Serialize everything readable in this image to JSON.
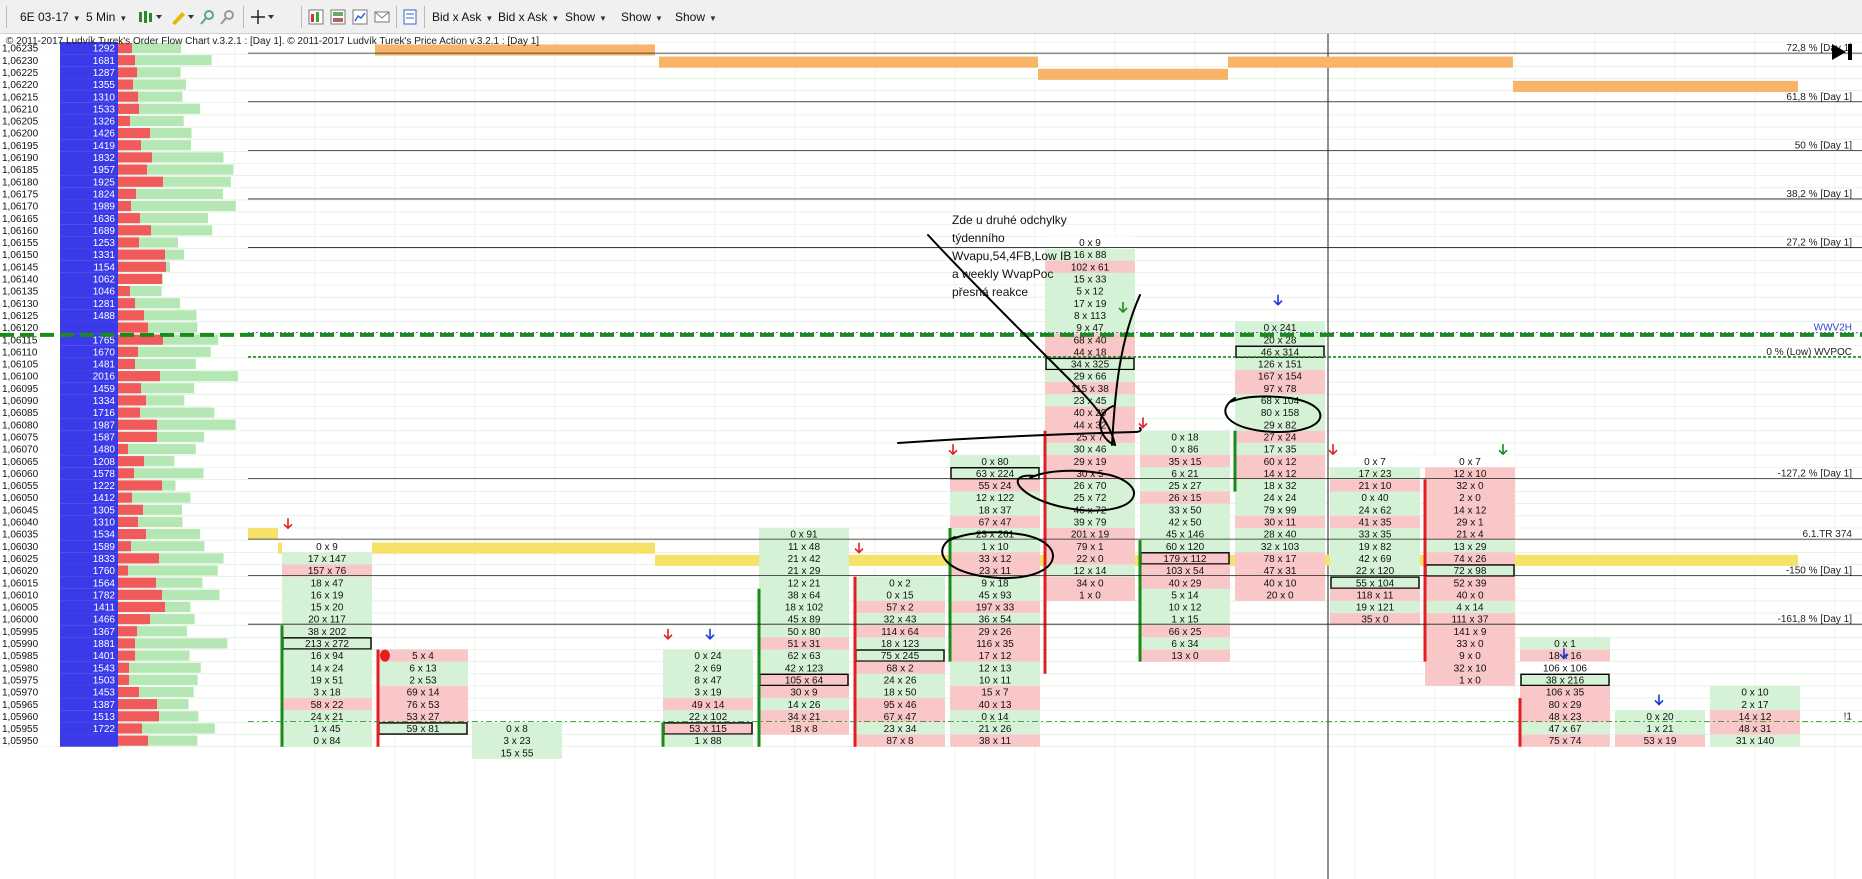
{
  "toolbar": {
    "instrument": "6E 03-17",
    "timeframe": "5 Min",
    "dropdowns": [
      "Bid x Ask",
      "Bid x Ask",
      "Show",
      "Show",
      "Show"
    ]
  },
  "copyright": "© 2011-2017 Ludvík Turek's Order Flow Chart v.3.2.1 : [Day 1]. © 2011-2017 Ludvík Turek's Price Action v.3.2.1 : [Day 1]",
  "note_lines": [
    "Zde u druhé odchylky",
    "týdenního",
    "Wvapu,54,4FB,Low IB",
    "a weekly WvapPoc",
    "přesná reakce"
  ],
  "colors": {
    "ask": "#f05a5a",
    "bid": "#b5e7b5",
    "volume": "#3a3ae8",
    "orange": "#f8b469",
    "yellow": "#f6e169",
    "green_line": "#1a8a1a"
  },
  "ladder": {
    "prices": [
      "1,06235",
      "1,06230",
      "1,06225",
      "1,06220",
      "1,06215",
      "1,06210",
      "1,06205",
      "1,06200",
      "1,06195",
      "1,06190",
      "1,06185",
      "1,06180",
      "1,06175",
      "1,06170",
      "1,06165",
      "1,06160",
      "1,06155",
      "1,06150",
      "1,06145",
      "1,06140",
      "1,06135",
      "1,06130",
      "1,06125",
      "1,06120",
      "1,06115",
      "1,06110",
      "1,06105",
      "1,06100",
      "1,06095",
      "1,06090",
      "1,06085",
      "1,06080",
      "1,06075",
      "1,06070",
      "1,06065",
      "1,06060",
      "1,06055",
      "1,06050",
      "1,06045",
      "1,06040",
      "1,06035",
      "1,06030",
      "1,06025",
      "1,06020",
      "1,06015",
      "1,06010",
      "1,06005",
      "1,06000",
      "1,05995",
      "1,05990",
      "1,05985",
      "1,05980",
      "1,05975",
      "1,05970",
      "1,05965",
      "1,05960",
      "1,05955",
      "1,05950"
    ],
    "volumes": [
      "1292",
      "1681",
      "1287",
      "1355",
      "1310",
      "1533",
      "1326",
      "1426",
      "1419",
      "1832",
      "1957",
      "1925",
      "1824",
      "1989",
      "1636",
      "1689",
      "1253",
      "1331",
      "1154",
      "1062",
      "1046",
      "1281",
      "1488",
      "",
      "1765",
      "1670",
      "1481",
      "2016",
      "1459",
      "1334",
      "1716",
      "1987",
      "1587",
      "1480",
      "1208",
      "1578",
      "1222",
      "1412",
      "1305",
      "1310",
      "1534",
      "1589",
      "1833",
      "1760",
      "1564",
      "1782",
      "1411",
      "1466",
      "1367",
      "1881",
      "1401",
      "1543",
      "1503",
      "1453",
      "1387",
      "1513",
      "1722"
    ]
  },
  "levels": [
    {
      "label": "72,8 % [Day 1]",
      "value": 1.06235
    },
    {
      "label": "61,8 % [Day 1]",
      "value": 1.06215
    },
    {
      "label": "50 % [Day 1]",
      "value": 1.06195
    },
    {
      "label": "38,2 % [Day 1]",
      "value": 1.06175
    },
    {
      "label": "27,2 % [Day 1]",
      "value": 1.06155
    },
    {
      "label": "WWV2H",
      "value": 1.0612
    },
    {
      "label": "0 % (Low) WVPOC",
      "value": 1.0611
    },
    {
      "label": "-127,2 % [Day 1]",
      "value": 1.0606
    },
    {
      "label": "6.1.TR 374",
      "value": 1.06035
    },
    {
      "label": "-150 % [Day 1]",
      "value": 1.0602
    },
    {
      "label": "-161,8 % [Day 1]",
      "value": 1.06
    },
    {
      "label": "!1",
      "value": 1.0596
    }
  ],
  "bars": [
    {
      "cells": [
        [
          "0 x 9",
          "n"
        ],
        [
          "17 x 147",
          "b"
        ],
        [
          "157 x 76",
          "a"
        ],
        [
          "18 x 47",
          "b"
        ],
        [
          "16 x 19",
          "b"
        ],
        [
          "15 x 20",
          "b"
        ],
        [
          "20 x 117",
          "b"
        ],
        [
          "38 x 202",
          "b"
        ],
        [
          "213 x 272",
          "b"
        ],
        [
          "16 x 94",
          "b"
        ],
        [
          "14 x 24",
          "b"
        ],
        [
          "19 x 51",
          "b"
        ],
        [
          "3 x 18",
          "b"
        ],
        [
          "58 x 22",
          "a"
        ],
        [
          "24 x 21",
          "b"
        ],
        [
          "1 x 45",
          "b"
        ],
        [
          "0 x 84",
          "b"
        ]
      ]
    },
    {
      "cells": [
        [
          "5 x 4",
          "a"
        ],
        [
          "6 x 13",
          "b"
        ],
        [
          "2 x 53",
          "b"
        ],
        [
          "69 x 14",
          "a"
        ],
        [
          "76 x 53",
          "a"
        ],
        [
          "53 x 27",
          "a"
        ],
        [
          "59 x 81",
          "b"
        ]
      ]
    },
    {
      "cells": [
        [
          "0 x 8",
          "b"
        ],
        [
          "3 x 23",
          "b"
        ],
        [
          "15 x 55",
          "b"
        ]
      ]
    },
    {
      "cells": [
        [
          "0 x 24",
          "b"
        ],
        [
          "2 x 69",
          "b"
        ],
        [
          "8 x 47",
          "b"
        ],
        [
          "3 x 19",
          "b"
        ],
        [
          "49 x 14",
          "a"
        ],
        [
          "22 x 102",
          "b"
        ],
        [
          "53 x 115",
          "a"
        ],
        [
          "1 x 88",
          "b"
        ]
      ]
    },
    {
      "cells": [
        [
          "0 x 91",
          "b"
        ],
        [
          "11 x 48",
          "b"
        ],
        [
          "21 x 42",
          "b"
        ],
        [
          "21 x 29",
          "b"
        ],
        [
          "12 x 21",
          "b"
        ],
        [
          "38 x 64",
          "b"
        ],
        [
          "18 x 102",
          "b"
        ],
        [
          "45 x 89",
          "b"
        ],
        [
          "50 x 80",
          "b"
        ],
        [
          "51 x 31",
          "a"
        ],
        [
          "62 x 63",
          "b"
        ],
        [
          "42 x 123",
          "b"
        ],
        [
          "105 x 64",
          "a"
        ],
        [
          "30 x 9",
          "a"
        ],
        [
          "14 x 26",
          "b"
        ],
        [
          "34 x 21",
          "a"
        ],
        [
          "18 x 8",
          "a"
        ]
      ]
    },
    {
      "cells": [
        [
          "0 x 2",
          "b"
        ],
        [
          "0 x 15",
          "b"
        ],
        [
          "57 x 2",
          "a"
        ],
        [
          "32 x 43",
          "b"
        ],
        [
          "114 x 64",
          "a"
        ],
        [
          "18 x 123",
          "b"
        ],
        [
          "75 x 245",
          "b"
        ],
        [
          "68 x 2",
          "a"
        ],
        [
          "24 x 26",
          "b"
        ],
        [
          "18 x 50",
          "b"
        ],
        [
          "95 x 46",
          "a"
        ],
        [
          "67 x 47",
          "a"
        ],
        [
          "23 x 34",
          "b"
        ],
        [
          "87 x 8",
          "a"
        ]
      ]
    },
    {
      "cells": [
        [
          "0 x 80",
          "b"
        ],
        [
          "63 x 224",
          "b"
        ],
        [
          "55 x 24",
          "a"
        ],
        [
          "12 x 122",
          "b"
        ],
        [
          "18 x 37",
          "b"
        ],
        [
          "67 x 47",
          "a"
        ],
        [
          "23 x 261",
          "b"
        ],
        [
          "1 x 10",
          "b"
        ],
        [
          "33 x 12",
          "a"
        ],
        [
          "23 x 11",
          "a"
        ],
        [
          "9 x 18",
          "b"
        ],
        [
          "45 x 93",
          "b"
        ],
        [
          "197 x 33",
          "a"
        ],
        [
          "36 x 54",
          "b"
        ],
        [
          "29 x 26",
          "a"
        ],
        [
          "116 x 35",
          "a"
        ],
        [
          "17 x 12",
          "a"
        ],
        [
          "12 x 13",
          "b"
        ],
        [
          "10 x 11",
          "b"
        ],
        [
          "15 x 7",
          "a"
        ],
        [
          "40 x 13",
          "a"
        ],
        [
          "0 x 14",
          "b"
        ],
        [
          "21 x 26",
          "b"
        ],
        [
          "38 x 11",
          "a"
        ]
      ]
    },
    {
      "cells": [
        [
          "0 x 9",
          "n"
        ],
        [
          "16 x 88",
          "b"
        ],
        [
          "102 x 61",
          "a"
        ],
        [
          "15 x 33",
          "b"
        ],
        [
          "5 x 12",
          "b"
        ],
        [
          "17 x 19",
          "b"
        ],
        [
          "8 x 113",
          "b"
        ],
        [
          "9 x 47",
          "b"
        ],
        [
          "68 x 40",
          "a"
        ],
        [
          "44 x 18",
          "a"
        ],
        [
          "34 x 325",
          "b"
        ],
        [
          "29 x 66",
          "b"
        ],
        [
          "115 x 38",
          "a"
        ],
        [
          "23 x 45",
          "b"
        ],
        [
          "40 x 29",
          "a"
        ],
        [
          "44 x 32",
          "a"
        ],
        [
          "25 x 7",
          "a"
        ],
        [
          "30 x 46",
          "b"
        ],
        [
          "29 x 19",
          "a"
        ],
        [
          "30 x 5",
          "a"
        ],
        [
          "26 x 70",
          "b"
        ],
        [
          "25 x 72",
          "b"
        ],
        [
          "46 x 72",
          "b"
        ],
        [
          "39 x 79",
          "b"
        ],
        [
          "201 x 19",
          "a"
        ],
        [
          "79 x 1",
          "a"
        ],
        [
          "22 x 0",
          "a"
        ],
        [
          "12 x 14",
          "b"
        ],
        [
          "34 x 0",
          "a"
        ],
        [
          "1 x 0",
          "a"
        ]
      ]
    },
    {
      "cells": [
        [
          "0 x 18",
          "b"
        ],
        [
          "0 x 86",
          "b"
        ],
        [
          "35 x 15",
          "a"
        ],
        [
          "6 x 21",
          "b"
        ],
        [
          "25 x 27",
          "b"
        ],
        [
          "26 x 15",
          "a"
        ],
        [
          "33 x 50",
          "b"
        ],
        [
          "42 x 50",
          "b"
        ],
        [
          "45 x 146",
          "b"
        ],
        [
          "60 x 120",
          "b"
        ],
        [
          "179 x 112",
          "a"
        ],
        [
          "103 x 54",
          "a"
        ],
        [
          "40 x 29",
          "a"
        ],
        [
          "5 x 14",
          "b"
        ],
        [
          "10 x 12",
          "b"
        ],
        [
          "1 x 15",
          "b"
        ],
        [
          "66 x 25",
          "a"
        ],
        [
          "6 x 34",
          "b"
        ],
        [
          "13 x 0",
          "a"
        ]
      ]
    },
    {
      "cells": [
        [
          "0 x 241",
          "b"
        ],
        [
          "20 x 28",
          "b"
        ],
        [
          "46 x 314",
          "b"
        ],
        [
          "126 x 151",
          "b"
        ],
        [
          "167 x 154",
          "a"
        ],
        [
          "97 x 78",
          "a"
        ],
        [
          "68 x 104",
          "b"
        ],
        [
          "80 x 158",
          "b"
        ],
        [
          "29 x 82",
          "b"
        ],
        [
          "27 x 24",
          "a"
        ],
        [
          "17 x 35",
          "b"
        ],
        [
          "60 x 12",
          "a"
        ],
        [
          "14 x 12",
          "a"
        ],
        [
          "18 x 32",
          "b"
        ],
        [
          "24 x 24",
          "b"
        ],
        [
          "79 x 99",
          "b"
        ],
        [
          "30 x 11",
          "a"
        ],
        [
          "28 x 40",
          "b"
        ],
        [
          "32 x 103",
          "b"
        ],
        [
          "78 x 17",
          "a"
        ],
        [
          "47 x 31",
          "a"
        ],
        [
          "40 x 10",
          "a"
        ],
        [
          "20 x 0",
          "a"
        ]
      ]
    },
    {
      "cells": [
        [
          "0 x 7",
          "n"
        ],
        [
          "17 x 23",
          "b"
        ],
        [
          "21 x 10",
          "a"
        ],
        [
          "0 x 40",
          "b"
        ],
        [
          "24 x 62",
          "b"
        ],
        [
          "41 x 35",
          "a"
        ],
        [
          "33 x 35",
          "b"
        ],
        [
          "19 x 82",
          "b"
        ],
        [
          "42 x 69",
          "b"
        ],
        [
          "22 x 120",
          "b"
        ],
        [
          "55 x 104",
          "b"
        ],
        [
          "118 x 11",
          "a"
        ],
        [
          "19 x 121",
          "b"
        ],
        [
          "35 x 0",
          "a"
        ]
      ]
    },
    {
      "cells": [
        [
          "0 x 7",
          "n"
        ],
        [
          "12 x 10",
          "a"
        ],
        [
          "32 x 0",
          "a"
        ],
        [
          "2 x 0",
          "a"
        ],
        [
          "14 x 12",
          "a"
        ],
        [
          "29 x 1",
          "a"
        ],
        [
          "21 x 4",
          "a"
        ],
        [
          "13 x 29",
          "b"
        ],
        [
          "74 x 26",
          "a"
        ],
        [
          "72 x 98",
          "b"
        ],
        [
          "52 x 39",
          "a"
        ],
        [
          "40 x 0",
          "a"
        ],
        [
          "4 x 14",
          "b"
        ],
        [
          "111 x 37",
          "a"
        ],
        [
          "141 x 9",
          "a"
        ],
        [
          "33 x 0",
          "a"
        ],
        [
          "9 x 0",
          "a"
        ],
        [
          "32 x 10",
          "a"
        ],
        [
          "1 x 0",
          "a"
        ]
      ]
    },
    {
      "cells": [
        [
          "0 x 1",
          "b"
        ],
        [
          "18 x 16",
          "a"
        ],
        [
          "106 x 106",
          "n"
        ],
        [
          "38 x 216",
          "b"
        ],
        [
          "106 x 35",
          "a"
        ],
        [
          "80 x 29",
          "a"
        ],
        [
          "48 x 23",
          "a"
        ],
        [
          "47 x 67",
          "b"
        ],
        [
          "75 x 74",
          "a"
        ]
      ]
    },
    {
      "cells": [
        [
          "0 x 20",
          "b"
        ],
        [
          "1 x 21",
          "b"
        ],
        [
          "53 x 19",
          "a"
        ]
      ]
    },
    {
      "cells": [
        [
          "0 x 10",
          "b"
        ],
        [
          "2 x 17",
          "b"
        ],
        [
          "14 x 12",
          "a"
        ],
        [
          "48 x 31",
          "a"
        ],
        [
          "31 x 140",
          "b"
        ]
      ]
    }
  ]
}
